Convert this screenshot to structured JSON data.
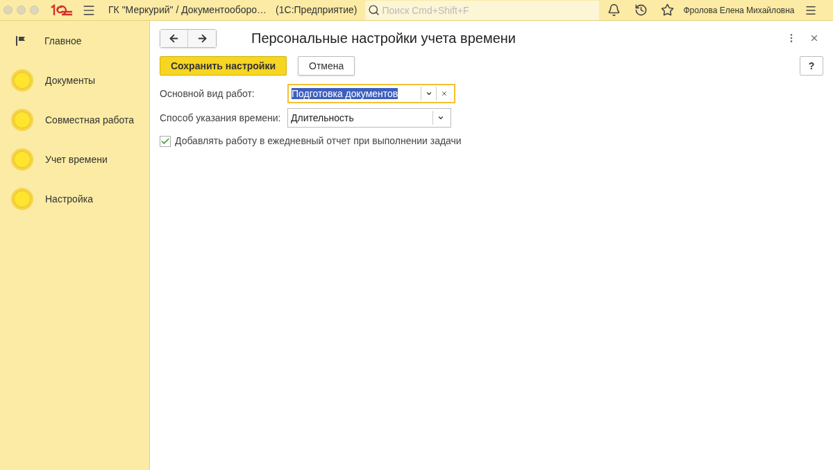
{
  "topbar": {
    "title": "ГК \"Меркурий\" / Документооборо…",
    "app": "(1С:Предприятие)",
    "search": {
      "placeholder": "Поиск Cmd+Shift+F"
    },
    "user": "Фролова Елена Михайловна"
  },
  "sidebar": {
    "items": [
      {
        "label": "Главное",
        "kind": "flag"
      },
      {
        "label": "Документы",
        "kind": "circle"
      },
      {
        "label": "Совместная работа",
        "kind": "circle"
      },
      {
        "label": "Учет времени",
        "kind": "circle"
      },
      {
        "label": "Настройка",
        "kind": "circle"
      }
    ]
  },
  "form": {
    "title": "Персональные настройки учета времени",
    "buttons": [
      {
        "label": "Сохранить настройки",
        "kind": "primary"
      },
      {
        "label": "Отмена",
        "kind": "default"
      }
    ],
    "help": "?",
    "fields": [
      {
        "label": "Основной вид работ:",
        "value": "Подготовка документов",
        "focused": true,
        "text_selected": true,
        "clearable": true
      },
      {
        "label": "Способ указания времени:",
        "value": "Длительность",
        "focused": false,
        "text_selected": false,
        "clearable": false
      }
    ],
    "checkbox": {
      "label": "Добавлять работу в ежедневный отчет при выполнении задачи",
      "checked": true
    }
  }
}
